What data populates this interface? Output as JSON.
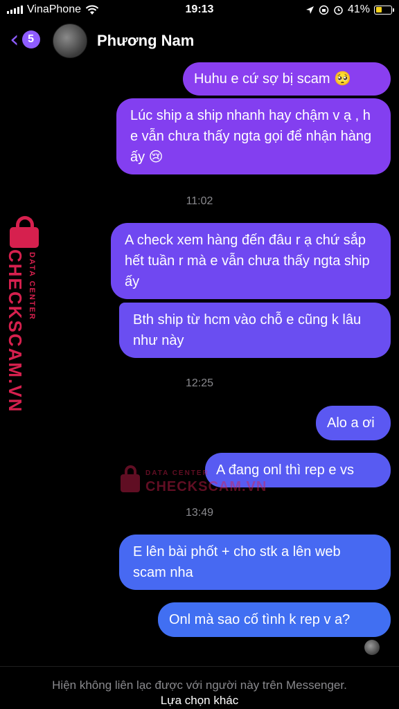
{
  "status_bar": {
    "carrier": "VinaPhone",
    "time": "19:13",
    "battery_percent": "41%",
    "battery_level": 0.41,
    "icons": [
      "signal-icon",
      "wifi-icon",
      "location-icon",
      "rotation-lock-icon",
      "alarm-icon",
      "battery-icon"
    ]
  },
  "header": {
    "back_icon": "chevron-left-icon",
    "unread_count": "5",
    "contact_name": "Phương Nam"
  },
  "messages": [
    {
      "text": "Huhu e cứ sợ bị scam 🥺"
    },
    {
      "text": "Lúc ship a ship nhanh hay chậm v ạ , h e vẫn chưa thấy ngta gọi để nhận hàng ấy 😢"
    },
    {
      "text": "A check xem hàng đến đâu r ạ chứ sắp hết tuần r mà e vẫn chưa thấy ngta ship ấy"
    },
    {
      "text": "Bth ship từ hcm vào chỗ e cũng k lâu như này"
    },
    {
      "text": "Alo a ơi"
    },
    {
      "text": "A đang onl thì rep e vs"
    },
    {
      "text": "E lên bài phốt + cho stk a lên web scam nha"
    },
    {
      "text": "Onl mà sao cố tình k rep v a?"
    }
  ],
  "timestamps": [
    "11:02",
    "12:25",
    "13:49"
  ],
  "watermark": {
    "brand": "CHECKSCAM.VN",
    "subtitle": "DATA CENTER"
  },
  "footer": {
    "notice": "Hiện không liên lạc được với người này trên Messenger.",
    "action": "Lựa chọn khác"
  },
  "colors": {
    "accent": "#8e5cff",
    "bubble_top": "#8a3ff0",
    "bubble_bottom": "#3f6ff2",
    "watermark": "#d6204e"
  }
}
